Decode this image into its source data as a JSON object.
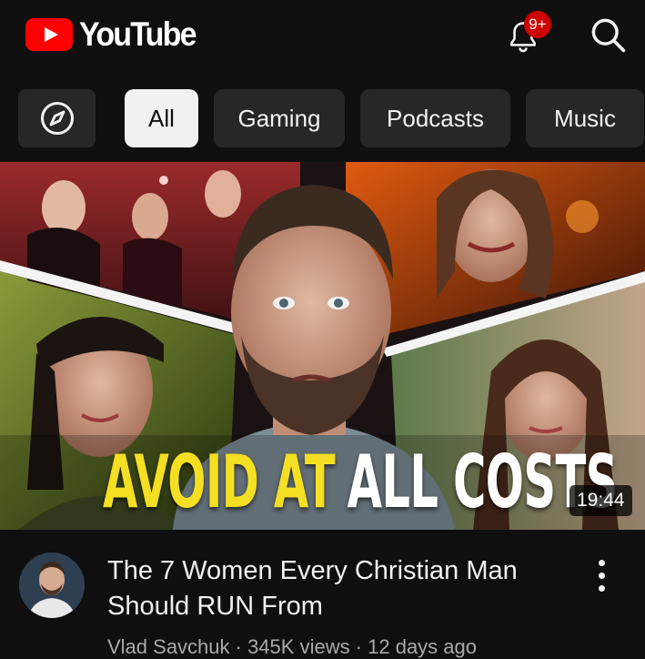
{
  "header": {
    "app_name": "YouTube",
    "notification_count": "9+",
    "icons": [
      "youtube-logo-icon",
      "bell-icon",
      "search-icon"
    ]
  },
  "chips": {
    "explore_icon": "compass-icon",
    "items": [
      {
        "label": "All",
        "selected": true
      },
      {
        "label": "Gaming",
        "selected": false
      },
      {
        "label": "Podcasts",
        "selected": false
      },
      {
        "label": "Music",
        "selected": false
      }
    ]
  },
  "video": {
    "thumbnail_text_part1": "AVOID AT",
    "thumbnail_text_part2": "ALL COSTS",
    "duration": "19:44",
    "title_line1": "The 7 Women Every Christian Man",
    "title_line2": "Should RUN From",
    "subline": "Vlad Savchuk · 345K views · 12 days ago",
    "menu_icon": "more-vert-icon"
  },
  "colors": {
    "background": "#0f0f0f",
    "brand_red": "#ff0000",
    "badge_red": "#cc0000",
    "chip_bg": "#272727",
    "chip_selected_bg": "#f1f1f1",
    "thumb_yellow": "#f5df22"
  }
}
